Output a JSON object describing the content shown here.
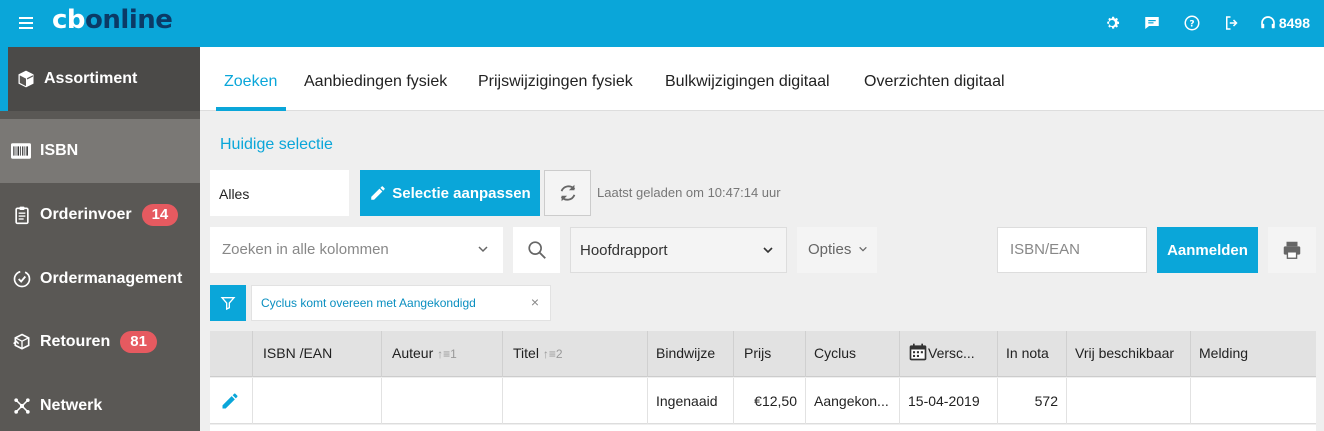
{
  "app": {
    "logo_cb": "cb",
    "logo_online": "online"
  },
  "topbar": {
    "support_number": "8498"
  },
  "sidebar": {
    "items": [
      {
        "label": "Assortiment"
      },
      {
        "label": "ISBN"
      },
      {
        "label": "Orderinvoer",
        "badge": "14"
      },
      {
        "label": "Ordermanagement"
      },
      {
        "label": "Retouren",
        "badge": "81"
      },
      {
        "label": "Netwerk"
      }
    ]
  },
  "tabs": [
    {
      "label": "Zoeken"
    },
    {
      "label": "Aanbiedingen fysiek"
    },
    {
      "label": "Prijswijzigingen fysiek"
    },
    {
      "label": "Bulkwijzigingen digitaal"
    },
    {
      "label": "Overzichten digitaal"
    }
  ],
  "selection": {
    "title": "Huidige selectie",
    "value": "Alles",
    "adjust_label": "Selectie aanpassen",
    "last_loaded": "Laatst geladen om 10:47:14 uur"
  },
  "toolbar": {
    "search_placeholder": "Zoeken in alle kolommen",
    "report": "Hoofdrapport",
    "options": "Opties",
    "isbn_placeholder": "ISBN/EAN",
    "register_label": "Aanmelden"
  },
  "filter": {
    "text": "Cyclus komt overeen met Aangekondigd",
    "close": "×"
  },
  "table": {
    "headers": {
      "isbn": "ISBN /EAN",
      "auteur": "Auteur",
      "auteur_sort": "↑≡1",
      "titel": "Titel",
      "titel_sort": "↑≡2",
      "bindwijze": "Bindwijze",
      "prijs": "Prijs",
      "cyclus": "Cyclus",
      "verschijning": "Versc...",
      "in_nota": "In nota",
      "vrij": "Vrij beschikbaar",
      "melding": "Melding"
    },
    "rows": [
      {
        "isbn": "",
        "auteur": "",
        "titel": "",
        "bindwijze": "Ingenaaid",
        "prijs": "€12,50",
        "cyclus": "Aangekon...",
        "verschijning": "15-04-2019",
        "in_nota": "572",
        "vrij": "",
        "melding": ""
      }
    ]
  },
  "colors": {
    "brand": "#0aa6d9",
    "logo_dark": "#0b3a66",
    "badge": "#e65a60",
    "sidebar": "#5a5855"
  }
}
